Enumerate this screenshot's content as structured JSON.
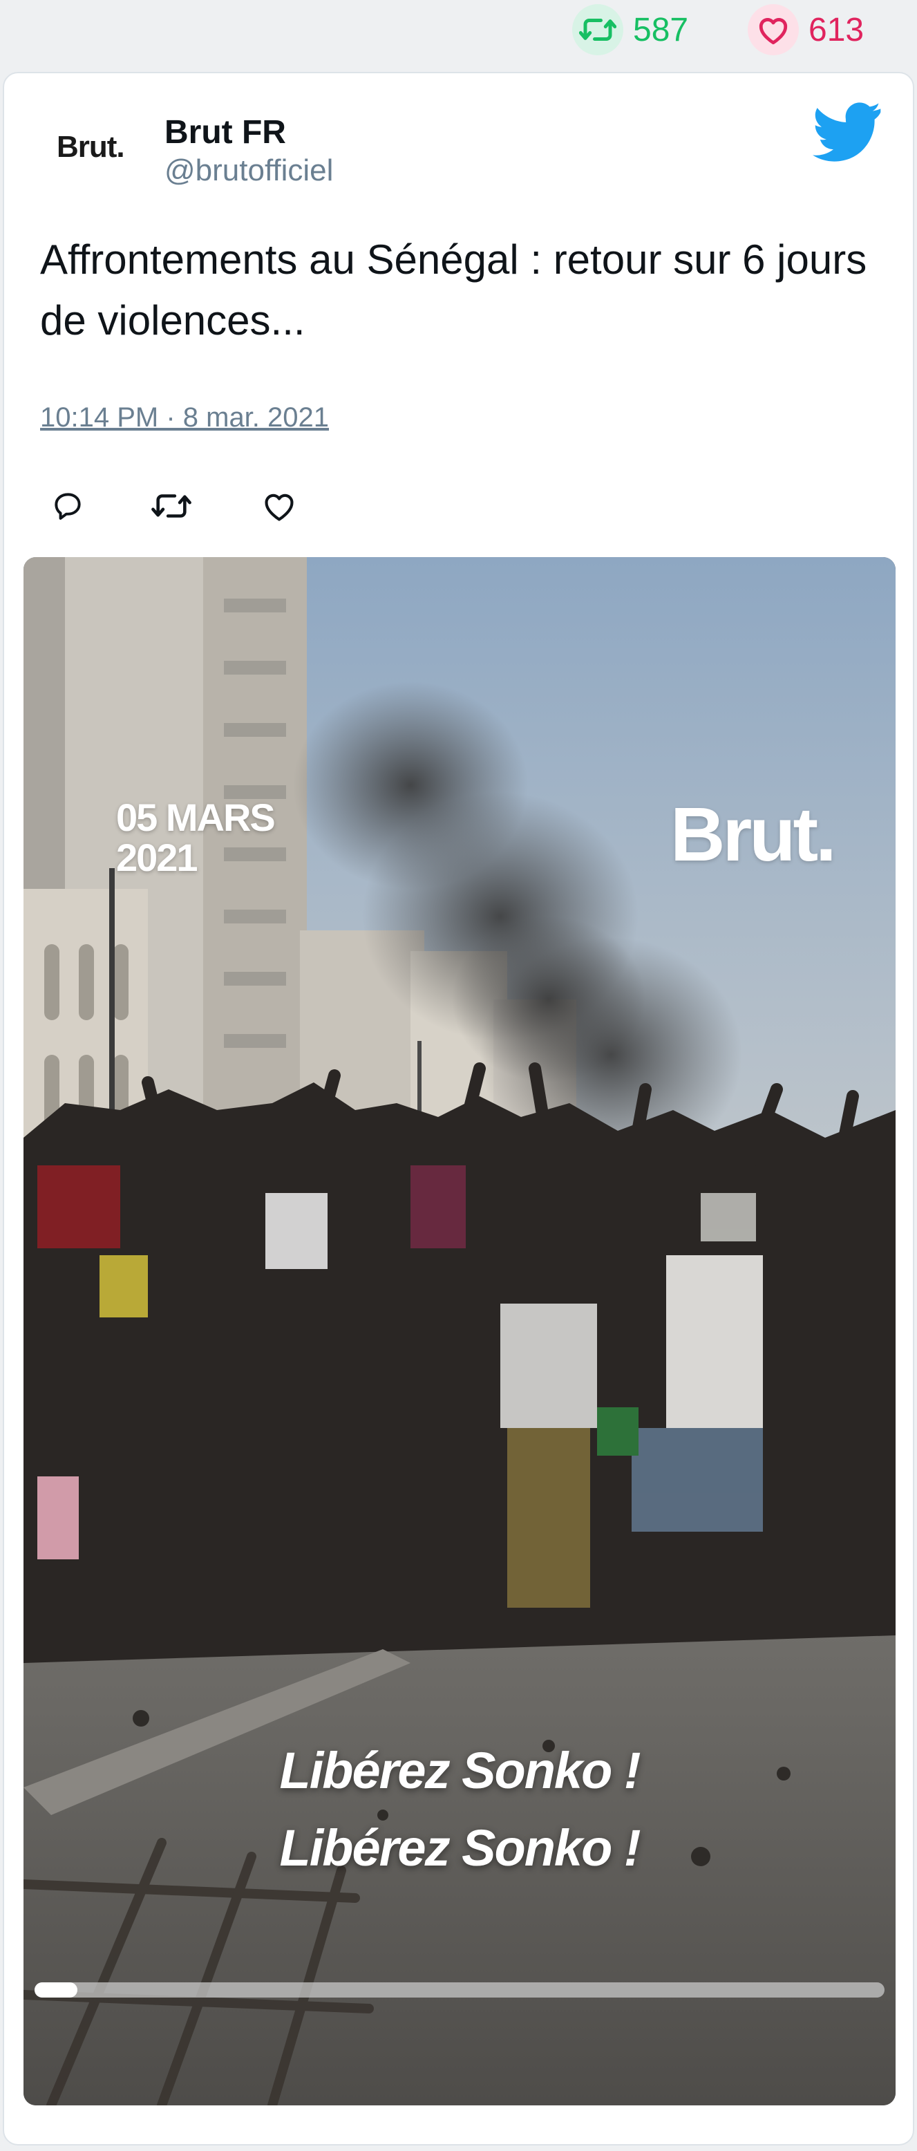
{
  "stats": {
    "retweets": "587",
    "likes": "613"
  },
  "tweet": {
    "logo_text": "Brut.",
    "author_name": "Brut FR",
    "author_handle": "@brutofficiel",
    "text": "Affrontements au Sénégal : retour sur 6 jours de violences...",
    "timestamp": "10:14 PM · 8 mar. 2021",
    "icons": {
      "platform": "twitter-bird-icon",
      "reply": "reply-icon",
      "retweet": "retweet-icon",
      "like": "heart-icon"
    }
  },
  "video": {
    "date_overlay": "05 MARS\n2021",
    "brand_overlay": "Brut.",
    "caption_line1": "Libérez Sonko !",
    "caption_line2": "Libérez Sonko !",
    "progress_fraction": 0.05
  },
  "colors": {
    "retweet_green": "#17bf63",
    "like_red": "#e0245e",
    "twitter_blue": "#1da1f2",
    "muted_text": "#6a7f91"
  }
}
